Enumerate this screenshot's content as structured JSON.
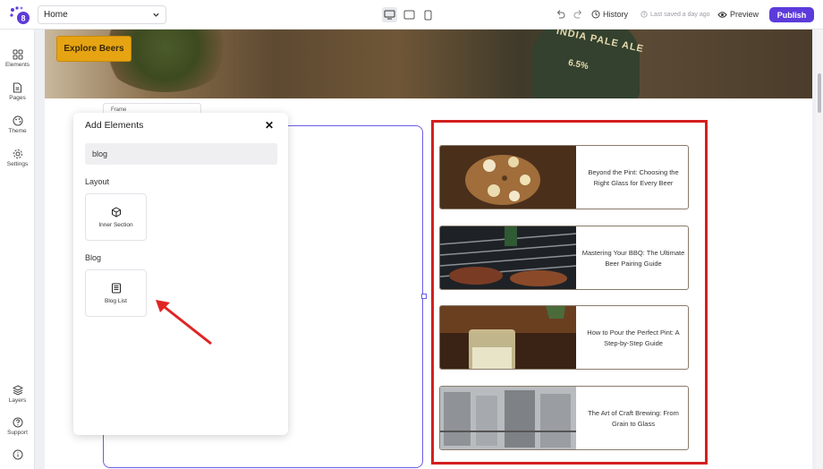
{
  "topbar": {
    "page_select": "Home",
    "history_label": "History",
    "saved_label": "Last saved a day ago",
    "preview_label": "Preview",
    "publish_label": "Publish"
  },
  "sidebar": {
    "items": [
      {
        "label": "Elements",
        "icon": "grid-icon"
      },
      {
        "label": "Pages",
        "icon": "page-icon"
      },
      {
        "label": "Theme",
        "icon": "palette-icon"
      },
      {
        "label": "Settings",
        "icon": "gear-icon"
      },
      {
        "label": "Layers",
        "icon": "layers-icon"
      },
      {
        "label": "Support",
        "icon": "help-icon"
      },
      {
        "label": "",
        "icon": "info-icon"
      }
    ]
  },
  "canvas": {
    "explore_label": "Explore Beers",
    "hero_label_1": "INDIA PALE ALE",
    "hero_label_2": "6.5%",
    "frame_tab_label": "Frame",
    "blog_posts": [
      {
        "title": "Beyond the Pint: Choosing the Right Glass for Every Beer"
      },
      {
        "title": "Mastering Your BBQ: The Ultimate Beer Pairing Guide"
      },
      {
        "title": "How to Pour the Perfect Pint: A Step-by-Step Guide"
      },
      {
        "title": "The Art of Craft Brewing: From Grain to Glass"
      }
    ]
  },
  "panel": {
    "title": "Add Elements",
    "search_value": "blog",
    "sections": [
      {
        "label": "Layout",
        "items": [
          {
            "label": "Inner Section",
            "icon": "cube-icon"
          }
        ]
      },
      {
        "label": "Blog",
        "items": [
          {
            "label": "Blog List",
            "icon": "list-icon"
          }
        ]
      }
    ]
  },
  "colors": {
    "accent": "#5c3bdb",
    "highlight": "#d41f1f",
    "explore_button": "#e6a413"
  }
}
